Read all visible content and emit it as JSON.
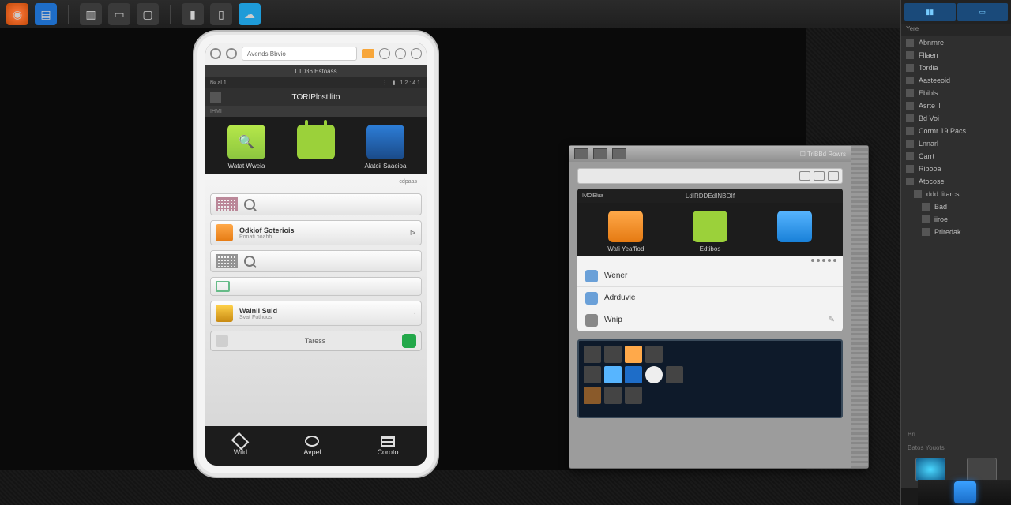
{
  "toolbar": {
    "items": [
      "home",
      "files",
      "stack",
      "tabs",
      "window",
      "sep",
      "flag",
      "bars",
      "cloud"
    ]
  },
  "toolbar_right": [
    "box",
    "menu",
    "globe"
  ],
  "phone": {
    "address": "Avends Bbvio",
    "status1": "I T036 Estoass",
    "status2_left": "№ al 1",
    "status2_right": "⋮ ▮ 12:41",
    "title": "TORIPlostilito",
    "sub_strip": "IHMI",
    "tiles": [
      {
        "label": "Watat Wweia"
      },
      {
        "label": ""
      },
      {
        "label": "Alatcii Saaeioa"
      }
    ],
    "light_header": "cdpaas",
    "rows": {
      "r1_title": "Odkiof Soteriois",
      "r1_sub": "Ponati ooahh",
      "r4_title": "Wainil Suid",
      "r4_sub": "Svat Futhuos"
    },
    "bottom_tab": "Taress",
    "nav": {
      "back": "Wild",
      "home": "Avpel",
      "recent": "Coroto"
    }
  },
  "emu": {
    "win_title": "☐ TriBBd Rowrs",
    "screen_title": "LdIRDDEdINBOIf",
    "screen_left": "IMOIBIua",
    "tiles": [
      {
        "label": "Wafi Yeaffiod"
      },
      {
        "label": "Edtibos"
      },
      {
        "label": ""
      }
    ],
    "list": [
      {
        "label": "Wener"
      },
      {
        "label": "Adrduvie"
      },
      {
        "label": "Wnip"
      }
    ]
  },
  "panel": {
    "tabs": [
      "▮▮",
      "▭"
    ],
    "section": "Yere",
    "tree": [
      {
        "lvl": 1,
        "label": "Abnrnre"
      },
      {
        "lvl": 1,
        "label": "Fllaen"
      },
      {
        "lvl": 1,
        "label": "Tordia"
      },
      {
        "lvl": 1,
        "label": "Aasteeoid"
      },
      {
        "lvl": 1,
        "label": "Ebibls"
      },
      {
        "lvl": 1,
        "label": "Asrte il"
      },
      {
        "lvl": 1,
        "label": "Bd Voi"
      },
      {
        "lvl": 1,
        "label": "Cormr 19 Pacs"
      },
      {
        "lvl": 1,
        "label": "Lnnarl"
      },
      {
        "lvl": 1,
        "label": "Carrt"
      },
      {
        "lvl": 1,
        "label": "Ribooa"
      },
      {
        "lvl": 1,
        "label": "Atocose"
      },
      {
        "lvl": 2,
        "label": "ddd Iitarcs"
      },
      {
        "lvl": 3,
        "label": "Bad"
      },
      {
        "lvl": 3,
        "label": "iiroe"
      },
      {
        "lvl": 3,
        "label": "Priredak"
      }
    ],
    "footer1": "Bri",
    "footer2": "Batos Youots"
  }
}
